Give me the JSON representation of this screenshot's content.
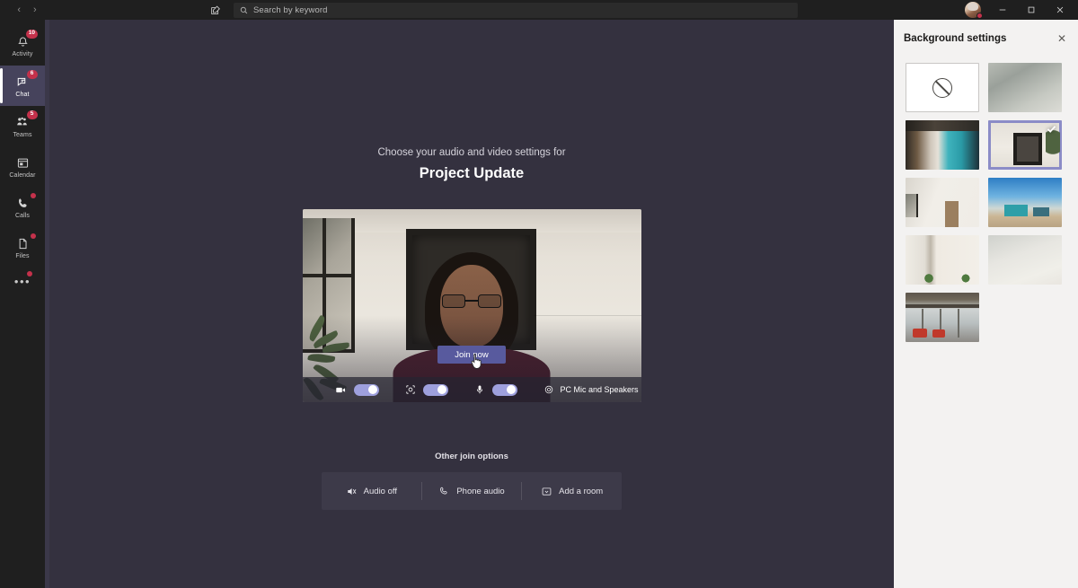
{
  "titlebar": {
    "back_label": "‹",
    "forward_label": "›",
    "compose_icon": "compose-icon",
    "search": {
      "icon": "search-icon",
      "placeholder": "Search by keyword",
      "value": ""
    },
    "avatar": "user-avatar",
    "status": "busy",
    "minimize_label": "—",
    "maximize_label": "▢",
    "close_label": "✕"
  },
  "rail": {
    "items": [
      {
        "label": "Activity",
        "icon": "bell-icon",
        "badge": "10",
        "active": false
      },
      {
        "label": "Chat",
        "icon": "chat-icon",
        "badge": "6",
        "active": true
      },
      {
        "label": "Teams",
        "icon": "teams-icon",
        "badge": "5",
        "active": false
      },
      {
        "label": "Calendar",
        "icon": "calendar-icon",
        "badge": "",
        "active": false
      },
      {
        "label": "Calls",
        "icon": "phone-icon",
        "badge": "dot",
        "active": false
      },
      {
        "label": "Files",
        "icon": "files-icon",
        "badge": "dot",
        "active": false
      }
    ],
    "more_label": "•••",
    "more_badge": "dot"
  },
  "prejoin": {
    "subtitle": "Choose your audio and video settings for",
    "title": "Project Update",
    "join_button": "Join now",
    "controls": {
      "camera": {
        "icon": "camera-icon",
        "state": "on"
      },
      "background": {
        "icon": "background-effects-icon",
        "state": "on"
      },
      "microphone": {
        "icon": "microphone-icon",
        "state": "on"
      },
      "device": {
        "icon": "gear-icon",
        "label": "PC Mic and Speakers"
      }
    },
    "other_options_title": "Other join options",
    "other_options": [
      {
        "label": "Audio off",
        "icon": "speaker-muted-icon"
      },
      {
        "label": "Phone audio",
        "icon": "phone-icon"
      },
      {
        "label": "Add a room",
        "icon": "add-room-icon"
      }
    ]
  },
  "panel": {
    "title": "Background settings",
    "close_label": "✕",
    "selected_index": 3,
    "thumbnails": [
      {
        "name": "None",
        "art": "none",
        "selected": false
      },
      {
        "name": "Blur",
        "art": "bg-blur-gray",
        "selected": false
      },
      {
        "name": "Cafe interior",
        "art": "bg-cafe",
        "selected": false
      },
      {
        "name": "Room with mirror",
        "art": "bg-mirror-room",
        "selected": true
      },
      {
        "name": "White room with window",
        "art": "bg-white-room",
        "selected": false
      },
      {
        "name": "Beach at dusk",
        "art": "bg-beach",
        "selected": false
      },
      {
        "name": "Curtained room",
        "art": "bg-curtain",
        "selected": false
      },
      {
        "name": "Blurred white wall",
        "art": "bg-blur-white",
        "selected": false
      },
      {
        "name": "Loft lounge",
        "art": "bg-loft",
        "selected": false
      }
    ]
  },
  "colors": {
    "rail_bg": "#1f1f1f",
    "rail_strip": "#3b3849",
    "stage_bg": "#34313f",
    "accent_purple": "#585a9e",
    "toggle_on": "#9ea0dd",
    "panel_bg": "#f3f2f1",
    "badge_red": "#c4314b",
    "selected_border": "#8b8cc7"
  }
}
